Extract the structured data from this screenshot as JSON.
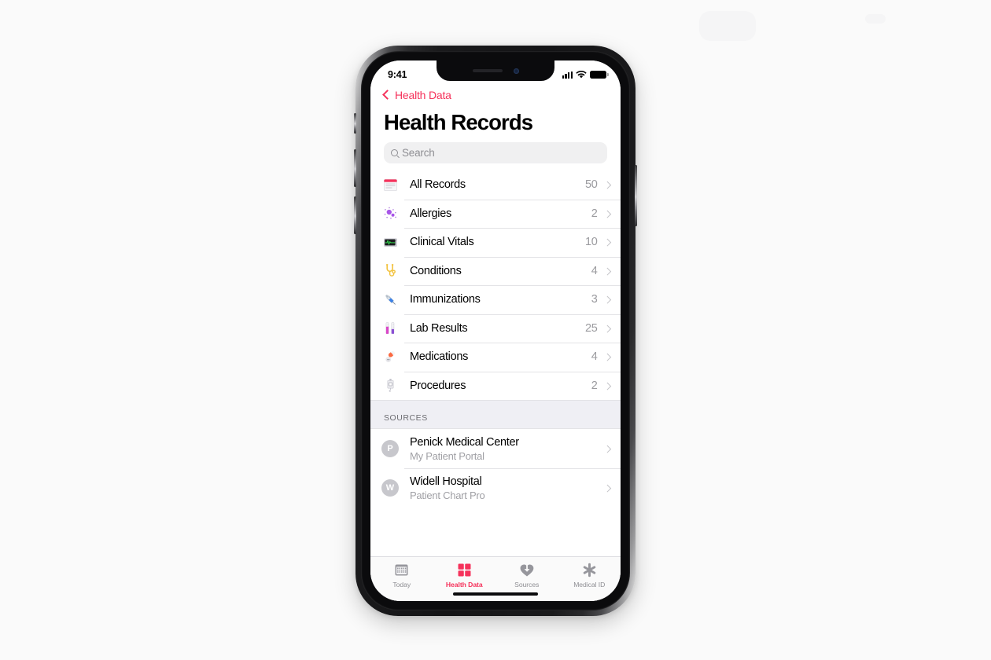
{
  "status_bar": {
    "time": "9:41",
    "signal_icon": "cellular-bars-icon",
    "wifi_icon": "wifi-icon",
    "battery_icon": "battery-full-icon"
  },
  "nav": {
    "back_icon": "chevron-left-icon",
    "back_label": "Health Data",
    "title": "Health Records"
  },
  "search": {
    "icon": "search-icon",
    "placeholder": "Search",
    "value": ""
  },
  "records": [
    {
      "label": "All Records",
      "count": "50",
      "icon": "all-records-icon",
      "chevron": "chevron-right-icon"
    },
    {
      "label": "Allergies",
      "count": "2",
      "icon": "allergies-icon",
      "chevron": "chevron-right-icon"
    },
    {
      "label": "Clinical Vitals",
      "count": "10",
      "icon": "clinical-vitals-icon",
      "chevron": "chevron-right-icon"
    },
    {
      "label": "Conditions",
      "count": "4",
      "icon": "conditions-icon",
      "chevron": "chevron-right-icon"
    },
    {
      "label": "Immunizations",
      "count": "3",
      "icon": "immunizations-icon",
      "chevron": "chevron-right-icon"
    },
    {
      "label": "Lab Results",
      "count": "25",
      "icon": "lab-results-icon",
      "chevron": "chevron-right-icon"
    },
    {
      "label": "Medications",
      "count": "4",
      "icon": "medications-icon",
      "chevron": "chevron-right-icon"
    },
    {
      "label": "Procedures",
      "count": "2",
      "icon": "procedures-icon",
      "chevron": "chevron-right-icon"
    }
  ],
  "sources_section": {
    "header": "SOURCES",
    "items": [
      {
        "initial": "P",
        "title": "Penick Medical Center",
        "subtitle": "My Patient Portal",
        "chevron": "chevron-right-icon"
      },
      {
        "initial": "W",
        "title": "Widell Hospital",
        "subtitle": "Patient Chart Pro",
        "chevron": "chevron-right-icon"
      }
    ]
  },
  "tabs": [
    {
      "label": "Today",
      "icon": "calendar-icon",
      "active": false
    },
    {
      "label": "Health Data",
      "icon": "grid-squares-icon",
      "active": true
    },
    {
      "label": "Sources",
      "icon": "heart-download-icon",
      "active": false
    },
    {
      "label": "Medical ID",
      "icon": "asterisk-icon",
      "active": false
    }
  ],
  "colors": {
    "accent": "#f5325b",
    "separator": "#e3e3e6",
    "section_bg": "#efeff4",
    "secondary_text": "#8e8e93"
  }
}
